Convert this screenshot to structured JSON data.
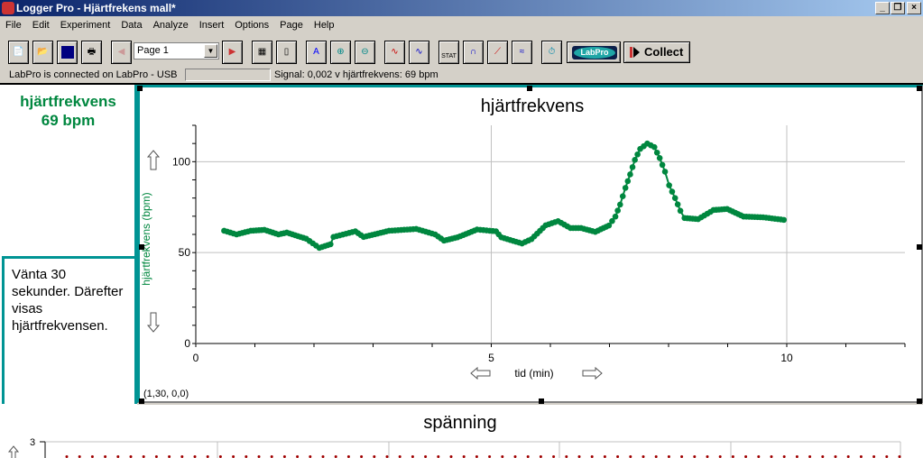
{
  "window": {
    "title": "Logger Pro - Hjärtfrekens mall*",
    "controls": [
      "minimize",
      "restore",
      "close"
    ]
  },
  "menu": [
    "File",
    "Edit",
    "Experiment",
    "Data",
    "Analyze",
    "Insert",
    "Options",
    "Page",
    "Help"
  ],
  "toolbar": {
    "page_select": "Page 1",
    "collect_label": "Collect",
    "labpro_label": "LabPro",
    "stat_label": "STAT",
    "buttons": [
      "new-icon",
      "open-icon",
      "save-icon",
      "print-icon",
      "previous-page-icon",
      "next-page-icon",
      "data-browser-icon",
      "sensor-icon",
      "autoscale-icon",
      "zoom-in-icon",
      "zoom-out-icon",
      "examine-icon",
      "tangent-icon",
      "statistics-icon",
      "integral-icon",
      "linear-fit-icon",
      "curve-fit-icon",
      "data-collection-icon",
      "labpro-icon",
      "collect-icon"
    ]
  },
  "status": {
    "connection": "LabPro is connected on LabPro - USB",
    "signal": "Signal: 0,002 v  hjärtfrekvens: 69 bpm"
  },
  "meter": {
    "label": "hjärtfrekvens",
    "value": "69 bpm",
    "color": "#00873f"
  },
  "textbox": {
    "text": "Vänta 30 sekunder. Därefter visas hjärtfrekvensen."
  },
  "graph1": {
    "coordinate_readout": "(1,30, 0,0)"
  },
  "graph2": {
    "title": "spänning",
    "y_tick_top": "3"
  },
  "chart_data": [
    {
      "type": "line",
      "title": "hjärtfrekvens",
      "xlabel": "tid (min)",
      "ylabel": "hjärtfrekvens (bpm)",
      "xlim": [
        0,
        12
      ],
      "ylim": [
        0,
        120
      ],
      "x_ticks": [
        0,
        5,
        10
      ],
      "y_ticks": [
        0,
        50,
        100
      ],
      "grid": true,
      "color": "#00873f",
      "markers": true,
      "x": [
        0.48,
        0.69,
        0.93,
        1.16,
        1.4,
        1.54,
        1.87,
        2.09,
        2.28,
        2.33,
        2.7,
        2.84,
        3.27,
        3.73,
        4.05,
        4.2,
        4.43,
        4.76,
        5.08,
        5.17,
        5.52,
        5.68,
        5.92,
        6.13,
        6.34,
        6.52,
        6.76,
        6.99,
        7.1,
        7.18,
        7.27,
        7.35,
        7.43,
        7.52,
        7.64,
        7.76,
        7.85,
        7.94,
        8.01,
        8.11,
        8.2,
        8.27,
        8.5,
        8.76,
        8.99,
        9.27,
        9.6,
        9.95
      ],
      "y": [
        62,
        60,
        62,
        62.5,
        60,
        61,
        57.6,
        52.6,
        54.6,
        58.6,
        61.7,
        58.6,
        62,
        63,
        60,
        56.6,
        58.4,
        62.7,
        61.7,
        58.4,
        55,
        57.4,
        65,
        67.3,
        63.5,
        63.5,
        61.4,
        64.9,
        69.8,
        76.4,
        85.6,
        93,
        101,
        107,
        110,
        108,
        102,
        94.5,
        87,
        80,
        73,
        69,
        68.4,
        73.4,
        74,
        69.8,
        69.4,
        68
      ]
    },
    {
      "type": "line",
      "title": "spänning",
      "y_ticks": [
        3
      ],
      "color": "#a00000",
      "partial": true
    }
  ]
}
